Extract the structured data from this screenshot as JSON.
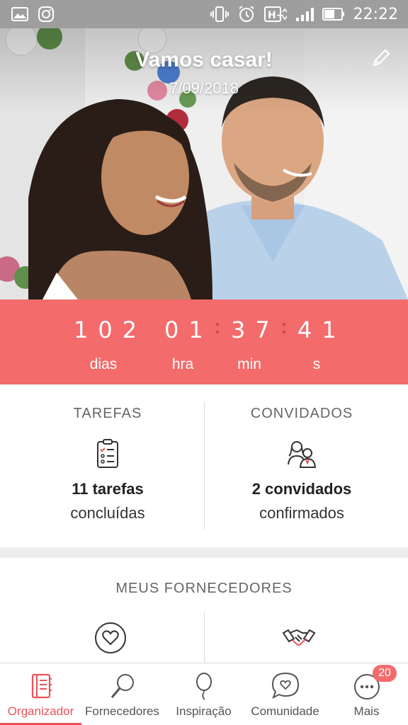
{
  "status_bar": {
    "time": "22:22",
    "icons": [
      "image-icon",
      "instagram-icon",
      "vibrate-icon",
      "alarm-icon",
      "hplus-network-icon",
      "signal-icon",
      "battery-icon"
    ]
  },
  "hero": {
    "title": "Vamos casar!",
    "date": "7/09/2018",
    "edit_icon": "pencil-icon"
  },
  "countdown": {
    "days": "102",
    "hours": "01",
    "minutes": "37",
    "seconds": "41",
    "labels": {
      "days": "dias",
      "hours": "hra",
      "minutes": "min",
      "seconds": "s"
    }
  },
  "tasks": {
    "title": "TAREFAS",
    "count": "11 tarefas",
    "subtitle": "concluídas",
    "icon": "checklist-icon"
  },
  "guests": {
    "title": "CONVIDADOS",
    "count": "2 convidados",
    "subtitle": "confirmados",
    "icon": "couple-icon"
  },
  "vendors": {
    "title": "MEUS FORNECEDORES",
    "icons": [
      "heart-icon",
      "handshake-icon"
    ]
  },
  "bottom_nav": {
    "items": [
      {
        "label": "Organizador",
        "icon": "notebook-icon",
        "active": true
      },
      {
        "label": "Fornecedores",
        "icon": "search-icon"
      },
      {
        "label": "Inspiração",
        "icon": "balloon-icon"
      },
      {
        "label": "Comunidade",
        "icon": "chat-heart-icon"
      },
      {
        "label": "Mais",
        "icon": "more-icon",
        "badge": "20"
      }
    ]
  },
  "colors": {
    "accent": "#f36b6b",
    "accent_dark": "#e8535a",
    "status_bar": "#9e9e9e"
  }
}
